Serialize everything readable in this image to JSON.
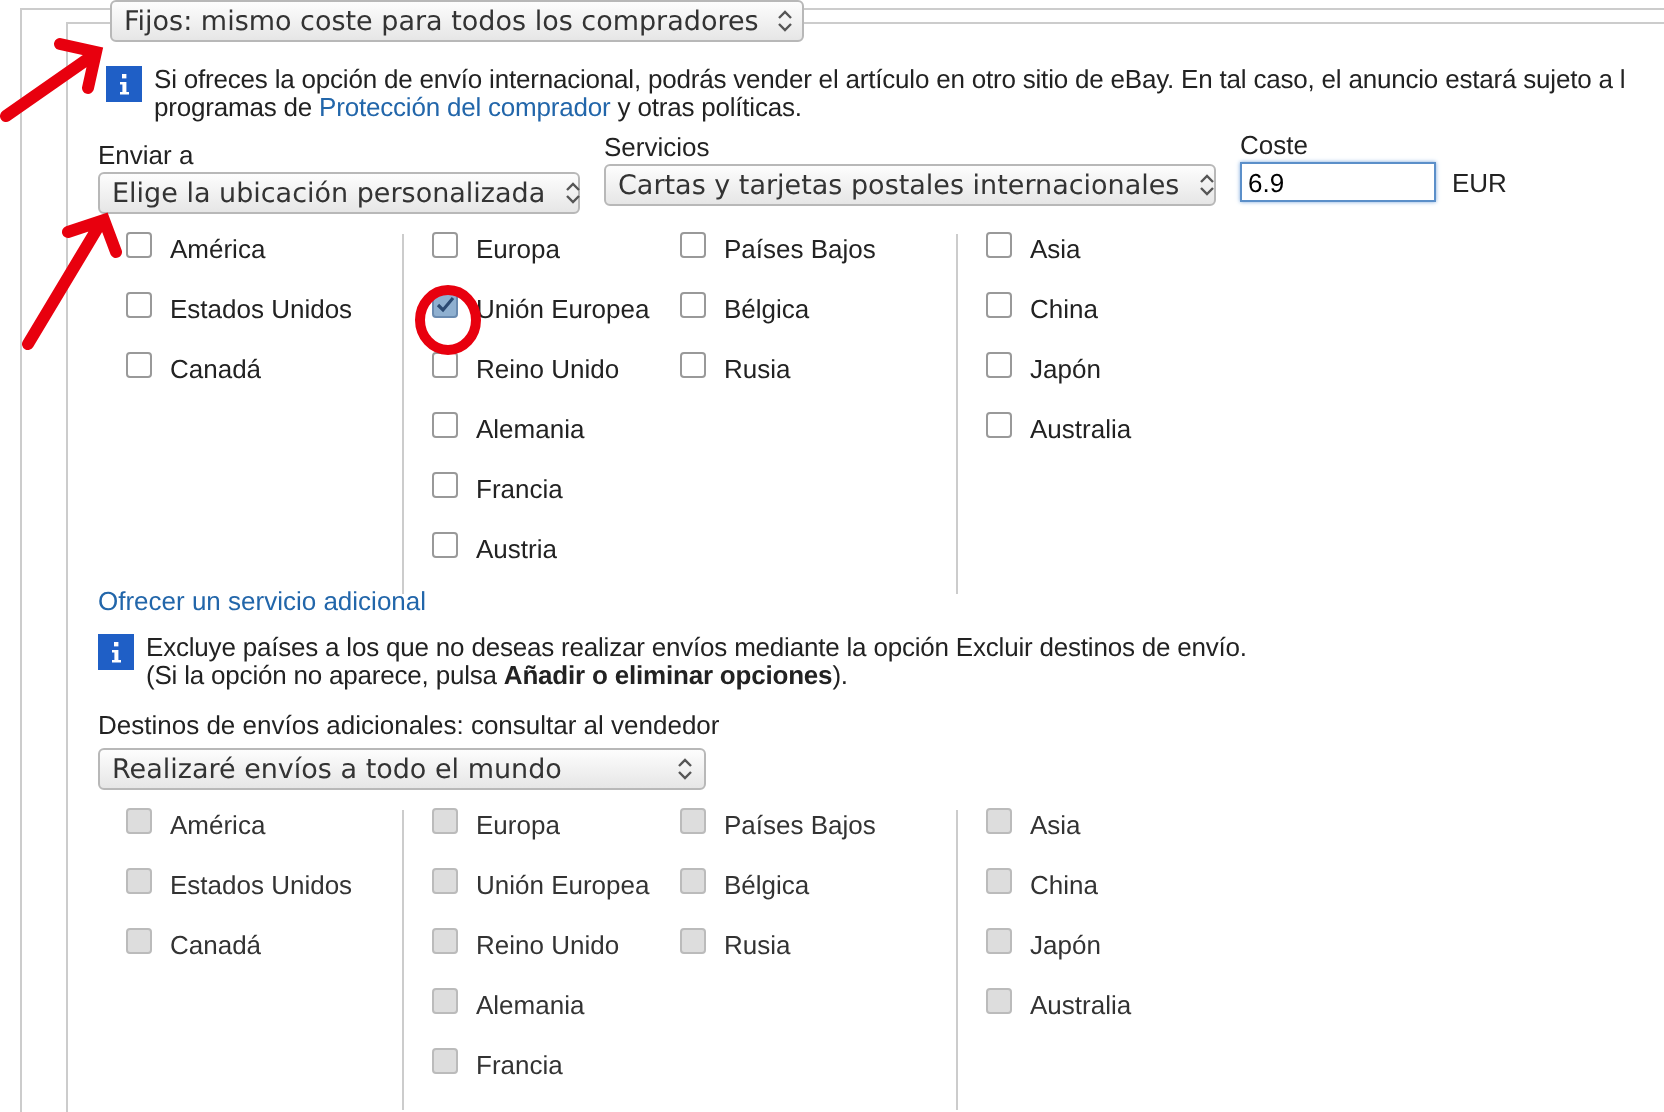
{
  "shipping_type_select": {
    "value": "Fijos: mismo coste para todos los compradores"
  },
  "notice": {
    "line_1": "Si ofreces la opción de envío internacional, podrás vender el artículo en otro sitio de eBay. En tal caso, el anuncio estará sujeto a l",
    "line_2_before": "programas de",
    "link": "Protección del comprador",
    "line_2_after": "y otras políticas."
  },
  "ship_to": {
    "label": "Enviar a",
    "value": "Elige la ubicación personalizada"
  },
  "services": {
    "label": "Servicios",
    "value": "Cartas y tarjetas postales internacionales"
  },
  "cost": {
    "label": "Coste",
    "value": "6.9",
    "currency": "EUR"
  },
  "regions": {
    "disabled": false,
    "groups": [
      {
        "columns": [
          [
            {
              "label": "América",
              "checked": false
            },
            {
              "label": "Estados Unidos",
              "checked": false
            },
            {
              "label": "Canadá",
              "checked": false
            }
          ]
        ]
      },
      {
        "columns": [
          [
            {
              "label": "Europa",
              "checked": false
            },
            {
              "label": "Unión Europea",
              "checked": true
            },
            {
              "label": "Reino Unido",
              "checked": false
            },
            {
              "label": "Alemania",
              "checked": false
            },
            {
              "label": "Francia",
              "checked": false
            },
            {
              "label": "Austria",
              "checked": false
            }
          ],
          [
            {
              "label": "Países Bajos",
              "checked": false
            },
            {
              "label": "Bélgica",
              "checked": false
            },
            {
              "label": "Rusia",
              "checked": false
            }
          ]
        ]
      },
      {
        "columns": [
          [
            {
              "label": "Asia",
              "checked": false
            },
            {
              "label": "China",
              "checked": false
            },
            {
              "label": "Japón",
              "checked": false
            },
            {
              "label": "Australia",
              "checked": false
            }
          ]
        ]
      }
    ]
  },
  "additional_service_link": "Ofrecer un servicio adicional",
  "exclude_notice": {
    "line_1": "Excluye países a los que no deseas realizar envíos mediante la opción Excluir destinos de envío.",
    "line_2": "(Si la opción no aparece, pulsa **Añadir o eliminar opciones**)."
  },
  "additional_destinations": {
    "label": "Destinos de envíos adicionales: consultar al vendedor",
    "value": "Realizaré envíos a todo el mundo"
  },
  "additional_regions": {
    "disabled": true,
    "groups": [
      {
        "columns": [
          [
            {
              "label": "América",
              "checked": false
            },
            {
              "label": "Estados Unidos",
              "checked": false
            },
            {
              "label": "Canadá",
              "checked": false
            }
          ]
        ]
      },
      {
        "columns": [
          [
            {
              "label": "Europa",
              "checked": false
            },
            {
              "label": "Unión Europea",
              "checked": false
            },
            {
              "label": "Reino Unido",
              "checked": false
            },
            {
              "label": "Alemania",
              "checked": false
            },
            {
              "label": "Francia",
              "checked": false
            }
          ],
          [
            {
              "label": "Países Bajos",
              "checked": false
            },
            {
              "label": "Bélgica",
              "checked": false
            },
            {
              "label": "Rusia",
              "checked": false
            }
          ]
        ]
      },
      {
        "columns": [
          [
            {
              "label": "Asia",
              "checked": false
            },
            {
              "label": "China",
              "checked": false
            },
            {
              "label": "Japón",
              "checked": false
            },
            {
              "label": "Australia",
              "checked": false
            }
          ]
        ]
      }
    ]
  }
}
